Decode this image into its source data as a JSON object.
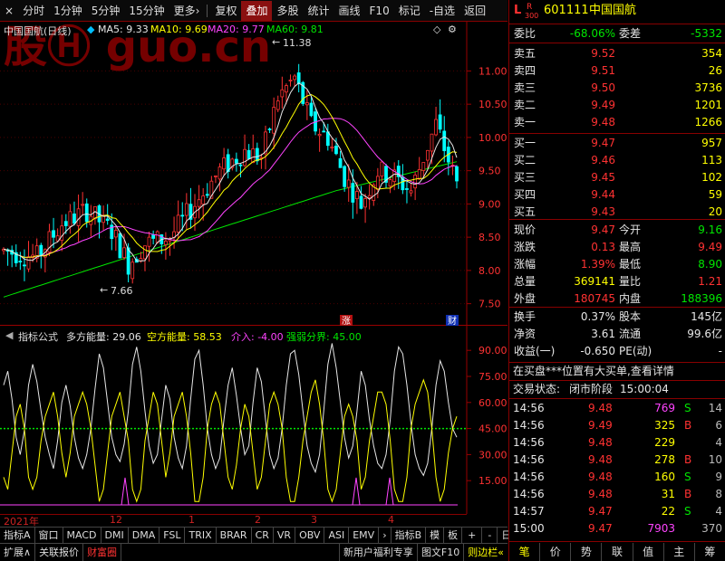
{
  "toolbar": {
    "close": "×",
    "items": [
      "分时",
      "1分钟",
      "5分钟",
      "15分钟",
      "更多›",
      "复权",
      "叠加",
      "多股",
      "统计",
      "画线",
      "F10",
      "标记",
      "-自选",
      "返回"
    ],
    "active": "叠加"
  },
  "main": {
    "stock_label": "中国国航(日线)",
    "ma5": "MA5: 9.33",
    "ma10": "MA10: 9.69",
    "ma20": "MA20: 9.77",
    "ma60": "MA60: 9.81",
    "high_mark": "11.38",
    "low_mark": "7.66",
    "badge_zhang": "涨",
    "badge_cai": "财",
    "watermark": "股Ⓗ guo.cn"
  },
  "indicator": {
    "formula": "指标公式",
    "buy_energy": "多方能量: 29.06",
    "sell_energy": "空方能量: 58.53",
    "intervention": "介入: -4.00",
    "strength_line": "强弱分界: 45.00"
  },
  "time_axis": [
    "2021年",
    "12",
    "1",
    "2",
    "3",
    "4"
  ],
  "tabs1": [
    "指标A",
    "窗口",
    "MACD",
    "DMI",
    "DMA",
    "FSL",
    "TRIX",
    "BRAR",
    "CR",
    "VR",
    "OBV",
    "ASI",
    "EMV",
    "›",
    "指标B",
    "模",
    "板",
    "+",
    "-",
    "日线"
  ],
  "tabs2": [
    "扩展∧",
    "关联报价",
    "财富圈",
    "新用户福利专享",
    "图文F10",
    "则边栏«"
  ],
  "panel": {
    "header_L": "L",
    "header_R": "R",
    "header_300": "300",
    "code": "601111",
    "name": "中国国航",
    "weibi_label": "委比",
    "weibi_value": "-68.06%",
    "weicha_label": "委差",
    "weicha_value": "-5332",
    "asks": [
      {
        "label": "卖五",
        "price": "9.52",
        "vol": "354"
      },
      {
        "label": "卖四",
        "price": "9.51",
        "vol": "26"
      },
      {
        "label": "卖三",
        "price": "9.50",
        "vol": "3736"
      },
      {
        "label": "卖二",
        "price": "9.49",
        "vol": "1201"
      },
      {
        "label": "卖一",
        "price": "9.48",
        "vol": "1266"
      }
    ],
    "bids": [
      {
        "label": "买一",
        "price": "9.47",
        "vol": "957"
      },
      {
        "label": "买二",
        "price": "9.46",
        "vol": "113"
      },
      {
        "label": "买三",
        "price": "9.45",
        "vol": "102"
      },
      {
        "label": "买四",
        "price": "9.44",
        "vol": "59"
      },
      {
        "label": "买五",
        "price": "9.43",
        "vol": "20"
      }
    ],
    "quote": [
      {
        "l1": "现价",
        "v1": "9.47",
        "c1": "red",
        "l2": "今开",
        "v2": "9.16",
        "c2": "green"
      },
      {
        "l1": "涨跌",
        "v1": "0.13",
        "c1": "red",
        "l2": "最高",
        "v2": "9.49",
        "c2": "red"
      },
      {
        "l1": "涨幅",
        "v1": "1.39%",
        "c1": "red",
        "l2": "最低",
        "v2": "8.90",
        "c2": "green"
      },
      {
        "l1": "总量",
        "v1": "369141",
        "c1": "yellow",
        "l2": "量比",
        "v2": "1.21",
        "c2": "red"
      },
      {
        "l1": "外盘",
        "v1": "180745",
        "c1": "red",
        "l2": "内盘",
        "v2": "188396",
        "c2": "green"
      }
    ],
    "stats": [
      {
        "l1": "换手",
        "v1": "0.37%",
        "l2": "股本",
        "v2": "145亿"
      },
      {
        "l1": "净资",
        "v1": "3.61",
        "l2": "流通",
        "v2": "99.6亿"
      },
      {
        "l1": "收益(一)",
        "v1": "-0.650",
        "l2": "PE(动)",
        "v2": "-"
      }
    ],
    "notice": "在买盘***位置有大买单,查看详情",
    "trade_status_label": "交易状态:",
    "trade_status": "闭市阶段",
    "trade_time": "15:00:04",
    "ticks": [
      {
        "time": "14:56",
        "price": "9.48",
        "vol": "769",
        "vc": "magenta",
        "bs": "S",
        "bc": "green",
        "n": "14"
      },
      {
        "time": "14:56",
        "price": "9.49",
        "vol": "325",
        "vc": "yellow",
        "bs": "B",
        "bc": "red",
        "n": "6"
      },
      {
        "time": "14:56",
        "price": "9.48",
        "vol": "229",
        "vc": "yellow",
        "bs": "",
        "bc": "white",
        "n": "4"
      },
      {
        "time": "14:56",
        "price": "9.48",
        "vol": "278",
        "vc": "yellow",
        "bs": "B",
        "bc": "red",
        "n": "10"
      },
      {
        "time": "14:56",
        "price": "9.48",
        "vol": "160",
        "vc": "yellow",
        "bs": "S",
        "bc": "green",
        "n": "9"
      },
      {
        "time": "14:56",
        "price": "9.48",
        "vol": "31",
        "vc": "yellow",
        "bs": "B",
        "bc": "red",
        "n": "8"
      },
      {
        "time": "14:57",
        "price": "9.47",
        "vol": "22",
        "vc": "yellow",
        "bs": "S",
        "bc": "green",
        "n": "4"
      },
      {
        "time": "15:00",
        "price": "9.47",
        "vol": "7903",
        "vc": "magenta",
        "bs": "",
        "bc": "white",
        "n": "370"
      }
    ],
    "bottom_tabs": [
      "笔",
      "价",
      "势",
      "联",
      "值",
      "主",
      "筹"
    ]
  },
  "chart_data": {
    "type": "candlestick",
    "price_axis": [
      "11.00",
      "10.50",
      "10.00",
      "9.50",
      "9.00",
      "8.50",
      "8.00",
      "7.50"
    ],
    "price_range": [
      7.25,
      11.55
    ],
    "indicator_axis": [
      "90.00",
      "75.00",
      "60.00",
      "45.00",
      "30.00",
      "15.00"
    ],
    "indicator_range": [
      0,
      100
    ]
  }
}
